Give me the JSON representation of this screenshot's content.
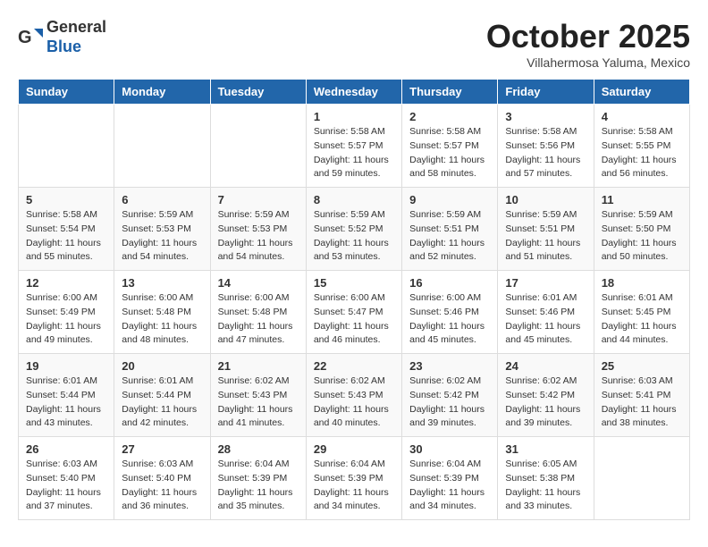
{
  "header": {
    "logo_general": "General",
    "logo_blue": "Blue",
    "month": "October 2025",
    "location": "Villahermosa Yaluma, Mexico"
  },
  "weekdays": [
    "Sunday",
    "Monday",
    "Tuesday",
    "Wednesday",
    "Thursday",
    "Friday",
    "Saturday"
  ],
  "weeks": [
    [
      {
        "day": "",
        "info": ""
      },
      {
        "day": "",
        "info": ""
      },
      {
        "day": "",
        "info": ""
      },
      {
        "day": "1",
        "info": "Sunrise: 5:58 AM\nSunset: 5:57 PM\nDaylight: 11 hours\nand 59 minutes."
      },
      {
        "day": "2",
        "info": "Sunrise: 5:58 AM\nSunset: 5:57 PM\nDaylight: 11 hours\nand 58 minutes."
      },
      {
        "day": "3",
        "info": "Sunrise: 5:58 AM\nSunset: 5:56 PM\nDaylight: 11 hours\nand 57 minutes."
      },
      {
        "day": "4",
        "info": "Sunrise: 5:58 AM\nSunset: 5:55 PM\nDaylight: 11 hours\nand 56 minutes."
      }
    ],
    [
      {
        "day": "5",
        "info": "Sunrise: 5:58 AM\nSunset: 5:54 PM\nDaylight: 11 hours\nand 55 minutes."
      },
      {
        "day": "6",
        "info": "Sunrise: 5:59 AM\nSunset: 5:53 PM\nDaylight: 11 hours\nand 54 minutes."
      },
      {
        "day": "7",
        "info": "Sunrise: 5:59 AM\nSunset: 5:53 PM\nDaylight: 11 hours\nand 54 minutes."
      },
      {
        "day": "8",
        "info": "Sunrise: 5:59 AM\nSunset: 5:52 PM\nDaylight: 11 hours\nand 53 minutes."
      },
      {
        "day": "9",
        "info": "Sunrise: 5:59 AM\nSunset: 5:51 PM\nDaylight: 11 hours\nand 52 minutes."
      },
      {
        "day": "10",
        "info": "Sunrise: 5:59 AM\nSunset: 5:51 PM\nDaylight: 11 hours\nand 51 minutes."
      },
      {
        "day": "11",
        "info": "Sunrise: 5:59 AM\nSunset: 5:50 PM\nDaylight: 11 hours\nand 50 minutes."
      }
    ],
    [
      {
        "day": "12",
        "info": "Sunrise: 6:00 AM\nSunset: 5:49 PM\nDaylight: 11 hours\nand 49 minutes."
      },
      {
        "day": "13",
        "info": "Sunrise: 6:00 AM\nSunset: 5:48 PM\nDaylight: 11 hours\nand 48 minutes."
      },
      {
        "day": "14",
        "info": "Sunrise: 6:00 AM\nSunset: 5:48 PM\nDaylight: 11 hours\nand 47 minutes."
      },
      {
        "day": "15",
        "info": "Sunrise: 6:00 AM\nSunset: 5:47 PM\nDaylight: 11 hours\nand 46 minutes."
      },
      {
        "day": "16",
        "info": "Sunrise: 6:00 AM\nSunset: 5:46 PM\nDaylight: 11 hours\nand 45 minutes."
      },
      {
        "day": "17",
        "info": "Sunrise: 6:01 AM\nSunset: 5:46 PM\nDaylight: 11 hours\nand 45 minutes."
      },
      {
        "day": "18",
        "info": "Sunrise: 6:01 AM\nSunset: 5:45 PM\nDaylight: 11 hours\nand 44 minutes."
      }
    ],
    [
      {
        "day": "19",
        "info": "Sunrise: 6:01 AM\nSunset: 5:44 PM\nDaylight: 11 hours\nand 43 minutes."
      },
      {
        "day": "20",
        "info": "Sunrise: 6:01 AM\nSunset: 5:44 PM\nDaylight: 11 hours\nand 42 minutes."
      },
      {
        "day": "21",
        "info": "Sunrise: 6:02 AM\nSunset: 5:43 PM\nDaylight: 11 hours\nand 41 minutes."
      },
      {
        "day": "22",
        "info": "Sunrise: 6:02 AM\nSunset: 5:43 PM\nDaylight: 11 hours\nand 40 minutes."
      },
      {
        "day": "23",
        "info": "Sunrise: 6:02 AM\nSunset: 5:42 PM\nDaylight: 11 hours\nand 39 minutes."
      },
      {
        "day": "24",
        "info": "Sunrise: 6:02 AM\nSunset: 5:42 PM\nDaylight: 11 hours\nand 39 minutes."
      },
      {
        "day": "25",
        "info": "Sunrise: 6:03 AM\nSunset: 5:41 PM\nDaylight: 11 hours\nand 38 minutes."
      }
    ],
    [
      {
        "day": "26",
        "info": "Sunrise: 6:03 AM\nSunset: 5:40 PM\nDaylight: 11 hours\nand 37 minutes."
      },
      {
        "day": "27",
        "info": "Sunrise: 6:03 AM\nSunset: 5:40 PM\nDaylight: 11 hours\nand 36 minutes."
      },
      {
        "day": "28",
        "info": "Sunrise: 6:04 AM\nSunset: 5:39 PM\nDaylight: 11 hours\nand 35 minutes."
      },
      {
        "day": "29",
        "info": "Sunrise: 6:04 AM\nSunset: 5:39 PM\nDaylight: 11 hours\nand 34 minutes."
      },
      {
        "day": "30",
        "info": "Sunrise: 6:04 AM\nSunset: 5:39 PM\nDaylight: 11 hours\nand 34 minutes."
      },
      {
        "day": "31",
        "info": "Sunrise: 6:05 AM\nSunset: 5:38 PM\nDaylight: 11 hours\nand 33 minutes."
      },
      {
        "day": "",
        "info": ""
      }
    ]
  ]
}
